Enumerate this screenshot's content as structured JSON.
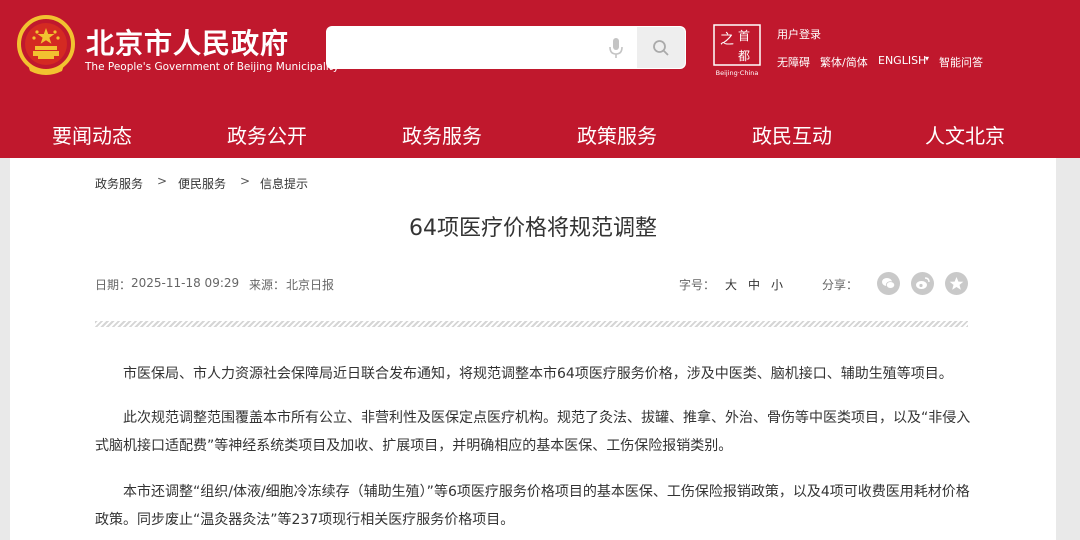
{
  "header": {
    "site_title": "北京市人民政府",
    "site_subtitle": "The People's Government of Beijing Municipality",
    "search": {
      "value": "",
      "placeholder": ""
    },
    "capital_logo": {
      "glyphs": "之首都",
      "caption": "Beijing·China"
    },
    "utility_links": {
      "login": "用户登录",
      "accessibility": "无障碍",
      "traditional_simplified": "繁体/简体",
      "english": "ENGLISH",
      "english_caret": "▾",
      "smart_qa": "智能问答"
    },
    "nav": [
      "要闻动态",
      "政务公开",
      "政务服务",
      "政策服务",
      "政民互动",
      "人文北京"
    ]
  },
  "breadcrumb": {
    "items": [
      "政务服务",
      "便民服务",
      "信息提示"
    ],
    "separator": ">"
  },
  "article": {
    "title": "64项医疗价格将规范调整",
    "date_label": "日期：",
    "date": "2025-11-18 09:29",
    "source_label": "来源：",
    "source": "北京日报",
    "font_size_label": "字号：",
    "font_sizes": [
      "大",
      "中",
      "小"
    ],
    "share_label": "分享：",
    "share_icons": [
      "wechat-icon",
      "weibo-icon",
      "favorite-icon"
    ],
    "paragraphs": [
      "市医保局、市人力资源社会保障局近日联合发布通知，将规范调整本市64项医疗服务价格，涉及中医类、脑机接口、辅助生殖等项目。",
      "此次规范调整范围覆盖本市所有公立、非营利性及医保定点医疗机构。规范了灸法、拔罐、推拿、外治、骨伤等中医类项目，以及“非侵入式脑机接口适配费”等神经系统类项目及加收、扩展项目，并明确相应的基本医保、工伤保险报销类别。",
      "本市还调整“组织/体液/细胞冷冻续存（辅助生殖）”等6项医疗服务价格项目的基本医保、工伤保险报销政策，以及4项可收费医用耗材价格政策。同步废止“温灸器灸法”等237项现行相关医疗服务价格项目。"
    ]
  },
  "colors": {
    "brand_red": "#c0182d",
    "emblem_gold": "#f2c230",
    "share_gray": "#c9c9c9"
  }
}
